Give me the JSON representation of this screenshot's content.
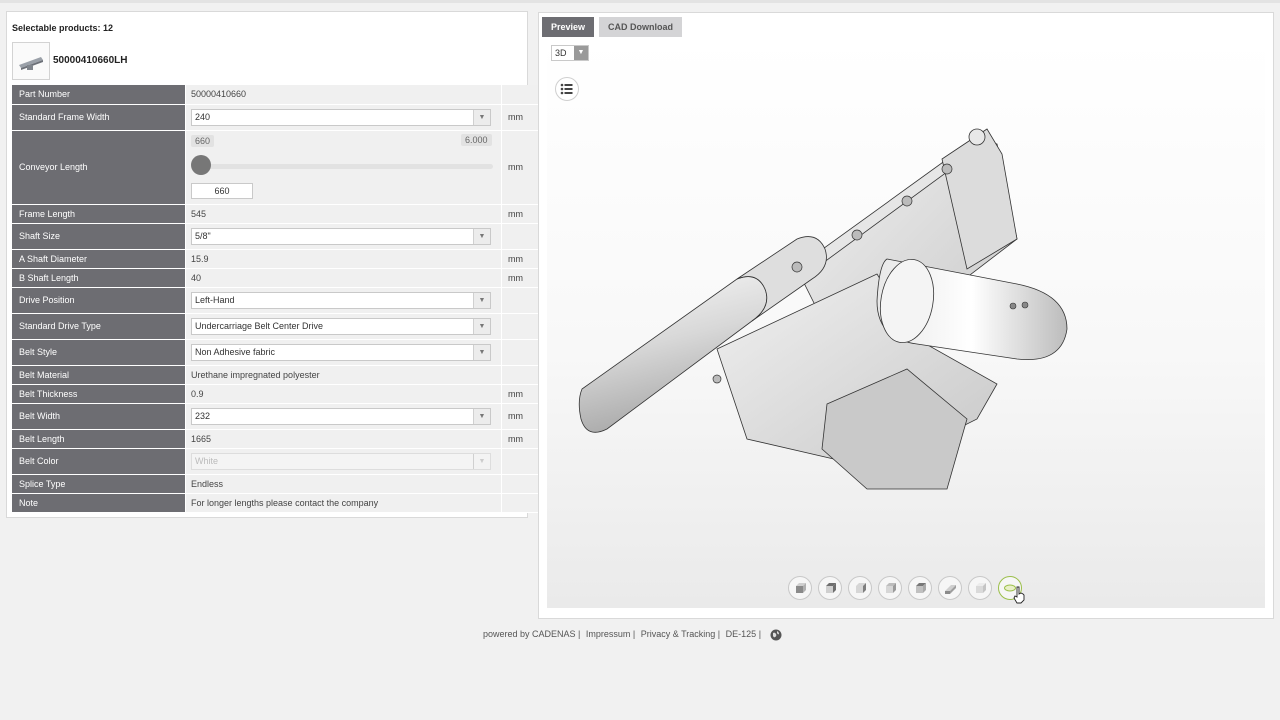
{
  "left": {
    "selectable_label": "Selectable products: 12",
    "product_name": "50000410660LH",
    "slider": {
      "min_badge": "660",
      "max_badge": "6.000",
      "value": "660",
      "fraction": 0.0
    },
    "rows": [
      {
        "label": "Part Number",
        "value": "50000410660",
        "unit": ""
      },
      {
        "label": "Standard Frame Width",
        "value": "240",
        "unit": "mm"
      },
      {
        "label": "Conveyor Length",
        "value": "",
        "unit": "mm"
      },
      {
        "label": "Frame Length",
        "value": "545",
        "unit": "mm"
      },
      {
        "label": "Shaft Size",
        "value": "5/8\"",
        "unit": ""
      },
      {
        "label": "A Shaft Diameter",
        "value": "15.9",
        "unit": "mm"
      },
      {
        "label": "B Shaft Length",
        "value": "40",
        "unit": "mm"
      },
      {
        "label": "Drive Position",
        "value": "Left-Hand",
        "unit": ""
      },
      {
        "label": "Standard Drive Type",
        "value": "Undercarriage Belt Center Drive",
        "unit": ""
      },
      {
        "label": "Belt Style",
        "value": "Non Adhesive fabric",
        "unit": ""
      },
      {
        "label": "Belt Material",
        "value": "Urethane impregnated polyester",
        "unit": ""
      },
      {
        "label": "Belt Thickness",
        "value": "0.9",
        "unit": "mm"
      },
      {
        "label": "Belt Width",
        "value": "232",
        "unit": "mm"
      },
      {
        "label": "Belt Length",
        "value": "1665",
        "unit": "mm"
      },
      {
        "label": "Belt Color",
        "value": "White",
        "unit": ""
      },
      {
        "label": "Splice Type",
        "value": "Endless",
        "unit": ""
      },
      {
        "label": "Note",
        "value": "For longer lengths please contact the company",
        "unit": ""
      }
    ]
  },
  "right": {
    "tabs": [
      {
        "label": "Preview"
      },
      {
        "label": "CAD Download"
      }
    ],
    "mode": "3D",
    "view_buttons": [
      "view-front-icon",
      "view-back-icon",
      "view-left-icon",
      "view-right-icon",
      "view-top-icon",
      "view-bottom-icon",
      "view-iso-icon",
      "view-fit-icon"
    ]
  },
  "footer": {
    "powered": "powered by CADENAS |",
    "impressum": "Impressum |",
    "privacy": "Privacy & Tracking |",
    "code": "DE-125 |"
  },
  "colors": {
    "label_bg": "#6d6d72",
    "value_bg": "#f0f0f0",
    "tab_active": "#6d6d72"
  }
}
